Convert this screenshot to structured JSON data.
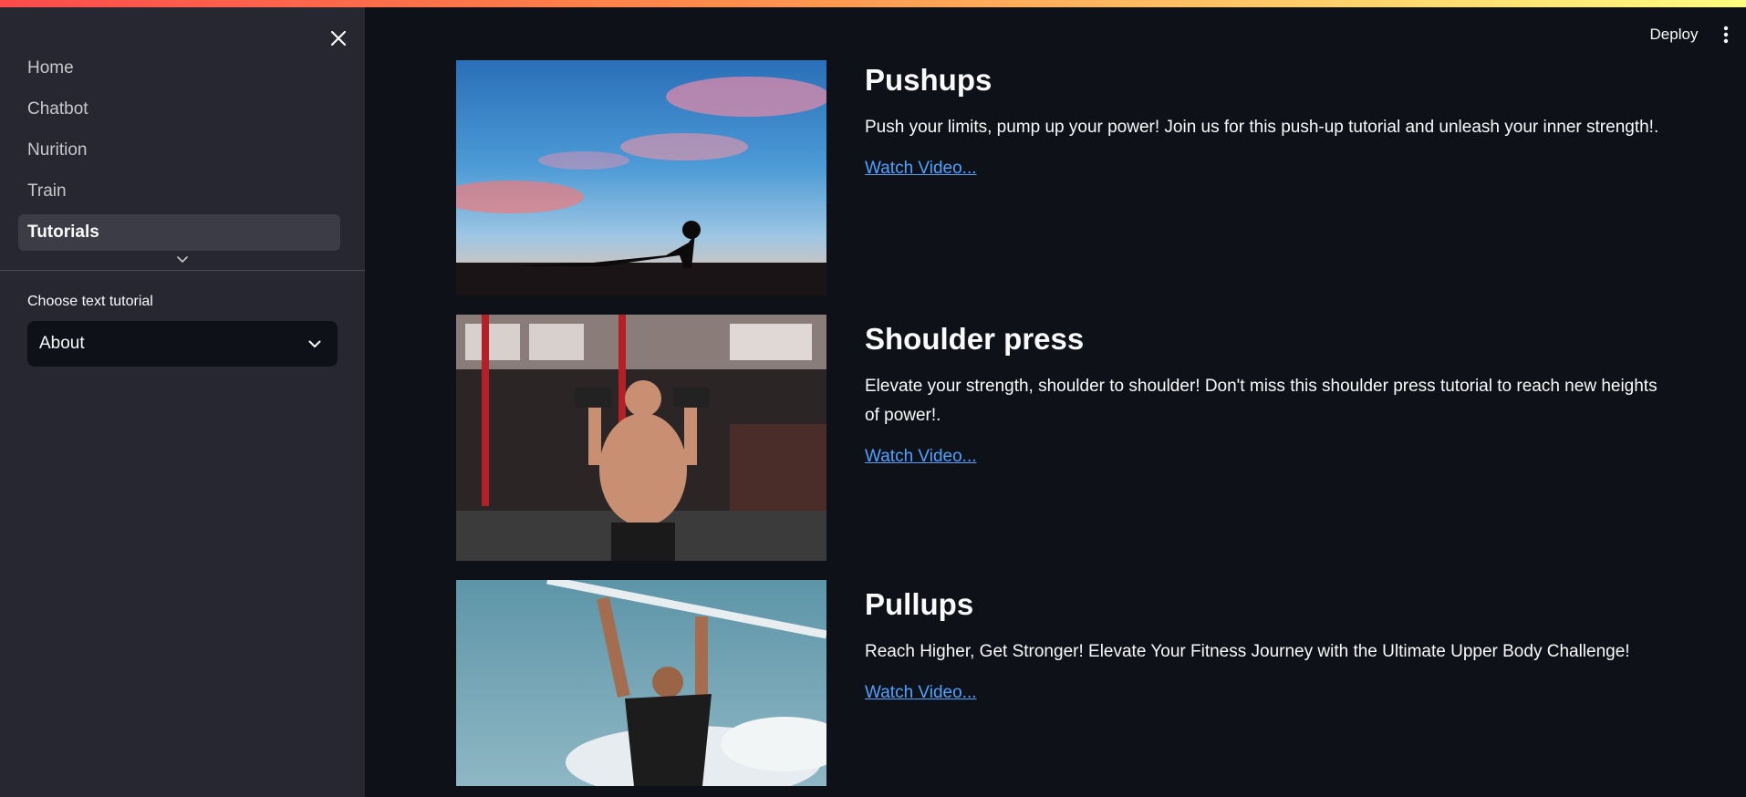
{
  "sidebar": {
    "nav_items": [
      {
        "label": "Home"
      },
      {
        "label": "Chatbot"
      },
      {
        "label": "Nurition"
      },
      {
        "label": "Train"
      },
      {
        "label": "Tutorials",
        "active": true
      }
    ],
    "select": {
      "label": "Choose text tutorial",
      "value": "About"
    }
  },
  "header": {
    "deploy_label": "Deploy"
  },
  "tutorials": [
    {
      "title": "Pushups",
      "description": "Push your limits, pump up your power! Join us for this push-up tutorial and unleash your inner strength!.",
      "link_label": "Watch Video..."
    },
    {
      "title": "Shoulder press",
      "description": "Elevate your strength, shoulder to shoulder! Don't miss this shoulder press tutorial to reach new heights of power!.",
      "link_label": "Watch Video..."
    },
    {
      "title": "Pullups",
      "description": "Reach Higher, Get Stronger! Elevate Your Fitness Journey with the Ultimate Upper Body Challenge!",
      "link_label": "Watch Video..."
    }
  ],
  "colors": {
    "background": "#0e1117",
    "sidebar": "#262730",
    "link": "#4ea3ff",
    "accent_gradient_start": "#ff4b4b",
    "accent_gradient_end": "#fffd80"
  },
  "icons": {
    "close": "close-icon",
    "chevron": "chevron-down-icon",
    "menu": "more-vertical-icon"
  }
}
